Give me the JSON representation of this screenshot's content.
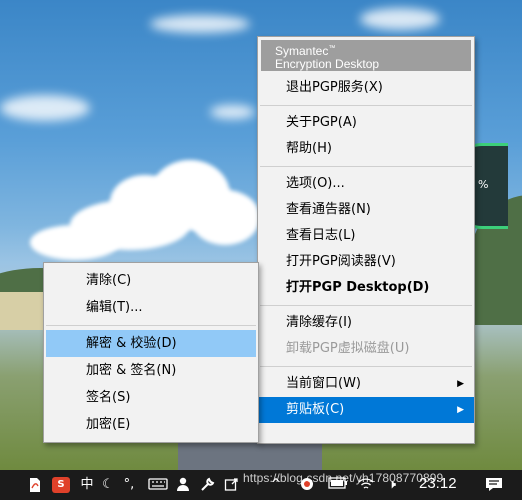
{
  "symantec_menu": {
    "brand_line1": "Symantec",
    "brand_tm": "™",
    "brand_line2": "Encryption Desktop",
    "items": [
      {
        "label": "退出PGP服务(X)"
      },
      {
        "label": "关于PGP(A)"
      },
      {
        "label": "帮助(H)"
      },
      {
        "label": "选项(O)..."
      },
      {
        "label": "查看通告器(N)"
      },
      {
        "label": "查看日志(L)"
      },
      {
        "label": "打开PGP阅读器(V)"
      },
      {
        "label": "打开PGP Desktop(D)"
      },
      {
        "label": "清除缓存(I)"
      },
      {
        "label": "卸载PGP虚拟磁盘(U)"
      },
      {
        "label": "当前窗口(W)"
      },
      {
        "label": "剪贴板(C)"
      }
    ]
  },
  "clipboard_menu": {
    "items": [
      {
        "label": "清除(C)"
      },
      {
        "label": "编辑(T)..."
      },
      {
        "label": "解密 & 校验(D)"
      },
      {
        "label": "加密 & 签名(N)"
      },
      {
        "label": "签名(S)"
      },
      {
        "label": "加密(E)"
      }
    ]
  },
  "taskbar": {
    "clock": "23:12",
    "ime_mode": "中",
    "punct": "°,",
    "input_logo": "S",
    "wps_logo": "W",
    "volume": "🕨"
  },
  "desktop": {
    "gauge_text": "%"
  },
  "watermark": "https://blog.csdn.net/yh17808770899"
}
